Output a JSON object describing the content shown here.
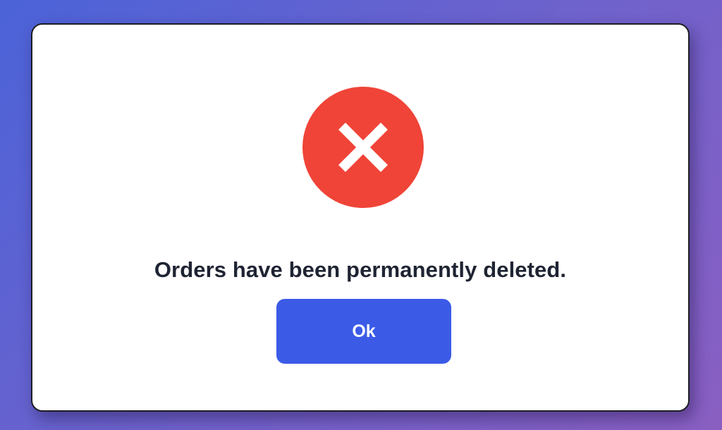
{
  "dialog": {
    "icon": "error-x-icon",
    "message": "Orders have been permanently deleted.",
    "ok_label": "Ok"
  },
  "colors": {
    "error": "#f04438",
    "primary_button": "#3b5be7",
    "text": "#1f2433"
  }
}
